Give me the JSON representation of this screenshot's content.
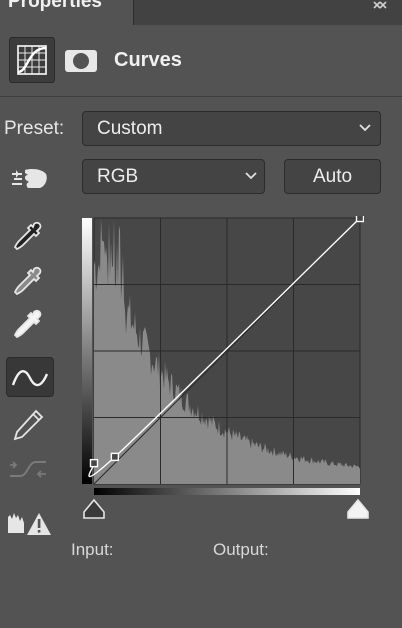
{
  "panel": {
    "tab_label": "Properties",
    "title": "Curves",
    "close_icon": "double-close-icon"
  },
  "preset": {
    "label": "Preset:",
    "value": "Custom"
  },
  "channel": {
    "value": "RGB"
  },
  "auto_button": {
    "label": "Auto"
  },
  "tools": [
    {
      "name": "target-adjustment-hand-icon",
      "active": false
    },
    {
      "name": "black-point-eyedropper-icon",
      "active": false
    },
    {
      "name": "gray-point-eyedropper-icon",
      "active": false
    },
    {
      "name": "white-point-eyedropper-icon",
      "active": false
    },
    {
      "name": "edit-points-curve-icon",
      "active": true
    },
    {
      "name": "pencil-draw-icon",
      "active": false
    },
    {
      "name": "smooth-curve-icon",
      "active": false
    },
    {
      "name": "clipping-warning-icon",
      "active": false
    }
  ],
  "curve": {
    "input_range": [
      0,
      255
    ],
    "output_range": [
      0,
      255
    ],
    "points": [
      [
        0,
        20
      ],
      [
        20,
        26
      ],
      [
        255,
        255
      ]
    ],
    "colors": {
      "graph_bg": "#474747",
      "histogram": "#8a8a8a",
      "curve": "#ffffff",
      "grid": "#2a2a2a"
    }
  },
  "readout": {
    "input_label": "Input:",
    "output_label": "Output:"
  }
}
